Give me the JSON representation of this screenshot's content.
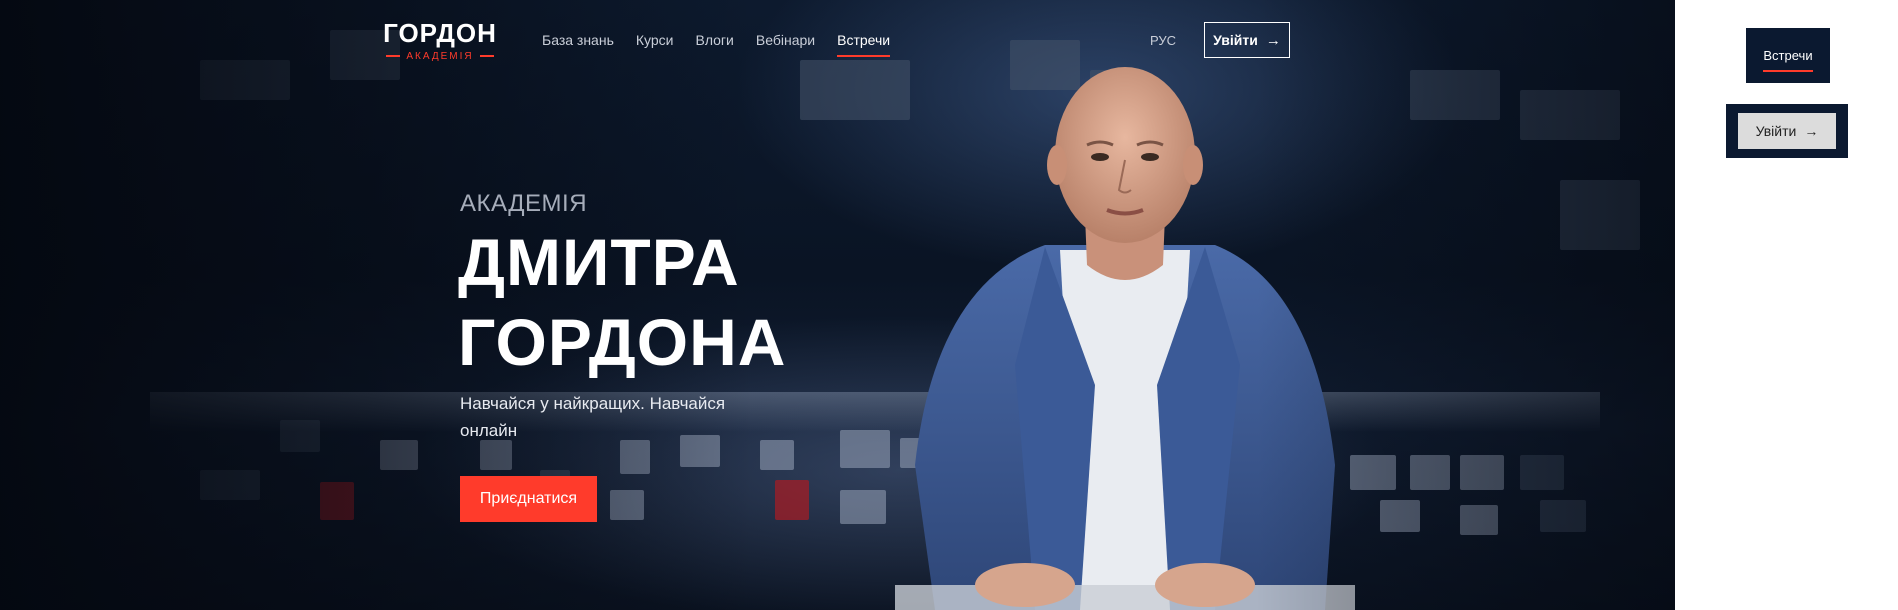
{
  "brand": {
    "name": "ГОРДОН",
    "subtitle": "АКАДЕМІЯ",
    "accent_color": "#ff3b2b",
    "dark_color": "#0b1930"
  },
  "nav": {
    "items": [
      {
        "label": "База знань",
        "active": false
      },
      {
        "label": "Курси",
        "active": false
      },
      {
        "label": "Влоги",
        "active": false
      },
      {
        "label": "Вебінари",
        "active": false
      },
      {
        "label": "Встречи",
        "active": true
      }
    ],
    "language": "РУС",
    "login_label": "Увійти",
    "login_icon": "arrow-right-icon"
  },
  "hero": {
    "kicker": "АКАДЕМІЯ",
    "title_line1": "ДМИТРА",
    "title_line2": "ГОРДОНА",
    "tagline": "Навчайся у найкращих. Навчайся онлайн",
    "cta_label": "Приєднатися"
  },
  "side_panel": {
    "active_tab_label": "Встречи",
    "login_label": "Увійти",
    "login_icon": "arrow-right-icon"
  }
}
